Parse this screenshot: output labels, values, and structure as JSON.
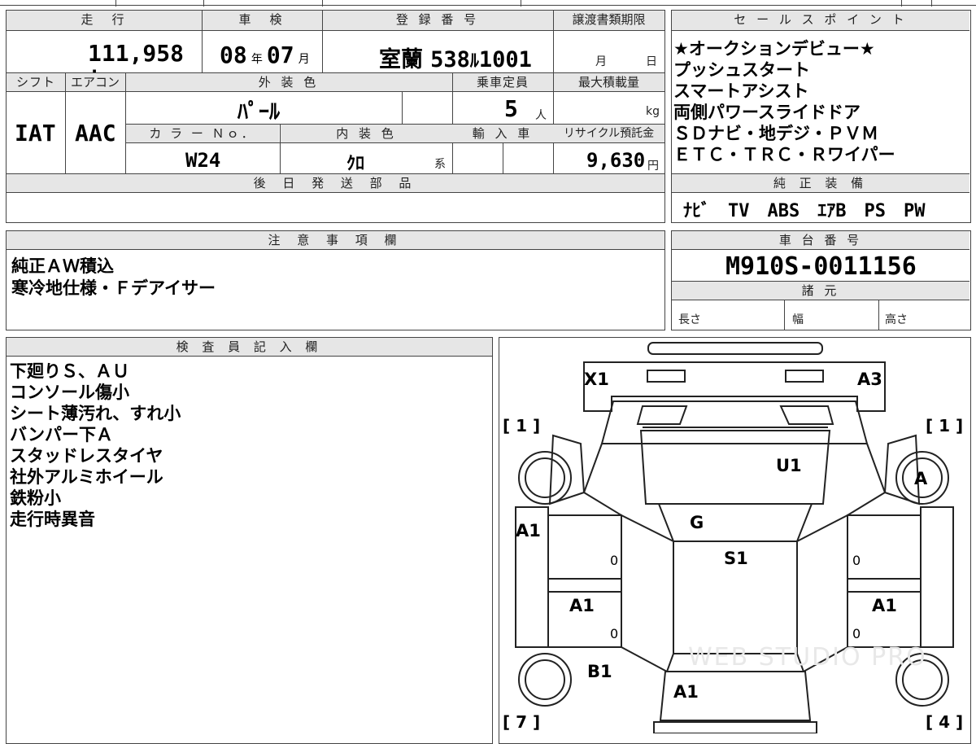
{
  "headers": {
    "mileage": "走　行",
    "inspection": "車　検",
    "registration": "登 録 番 号",
    "transfer_deadline": "譲渡書類期限",
    "sales_points": "セ ー ル ス ポ イ ン ト",
    "shift": "シフト",
    "aircon": "エアコン",
    "exterior_color": "外 装 色",
    "capacity": "乗車定員",
    "max_load": "最大積載量",
    "color_no": "カ ラ ー Ｎｏ．",
    "interior_color": "内 装 色",
    "import": "輸 入 車",
    "recycle_fee": "リサイクル預託金",
    "later_parts": "後 日 発 送 部 品",
    "genuine_equipment": "純 正 装 備",
    "notes": "注 意 事 項 欄",
    "chassis_number": "車 台 番 号",
    "specs": "諸 元",
    "inspector": "検 査 員 記 入 欄"
  },
  "mileage": {
    "value": "111,958",
    "unit": "km"
  },
  "inspection": {
    "year": "08",
    "year_unit": "年",
    "month": "07",
    "month_unit": "月"
  },
  "registration": {
    "area": "室蘭",
    "class": "538",
    "kana": "ﾙ",
    "number": "1001"
  },
  "transfer_deadline": {
    "month_unit": "月",
    "day_unit": "日"
  },
  "shift": "IAT",
  "aircon": "AAC",
  "exterior_color": "ﾊﾟｰﾙ",
  "capacity": {
    "value": "5",
    "unit": "人"
  },
  "max_load": {
    "unit": "kg"
  },
  "color_no": "W24",
  "interior_color": {
    "value": "ｸﾛ",
    "suffix": "系"
  },
  "recycle_fee": {
    "value": "9,630",
    "unit": "円"
  },
  "sales_points": [
    "★オークションデビュー★",
    "プッシュスタート",
    "スマートアシスト",
    "両側パワースライドドア",
    "ＳＤナビ・地デジ・ＰＶＭ",
    "ＥＴＣ・ＴＲＣ・Ｒワイパー"
  ],
  "genuine_equipment": "ﾅﾋﾞ　TV　ABS　ｴｱB　PS　PW",
  "notes": [
    "純正ＡＷ積込",
    "寒冷地仕様・Ｆデアイサー"
  ],
  "chassis_number": "M910S-0011156",
  "specs": {
    "length": "長さ",
    "width": "幅",
    "height": "高さ"
  },
  "inspector_notes": [
    "下廻りＳ、ＡＵ",
    "コンソール傷小",
    "シート薄汚れ、すれ小",
    "バンパー下Ａ",
    "スタッドレスタイヤ",
    "社外アルミホイール",
    "鉄粉小",
    "走行時異音"
  ],
  "diagram": {
    "front_left": "X1",
    "front_right": "A3",
    "roof": "U1",
    "glass": "G",
    "floor": "S1",
    "left_front_door": "A1",
    "left_rear_door": "A1",
    "left_rear_panel": "B1",
    "right_rear_door": "A1",
    "right_front_wheel": "A",
    "tailgate": "A1",
    "tire_fl": "[ 1 ]",
    "tire_fr": "[ 1 ]",
    "tire_rl": "[ 7 ]",
    "tire_rr": "[ 4 ]",
    "marker_0": "0",
    "watermark": "WEB STUDIO PRO"
  }
}
